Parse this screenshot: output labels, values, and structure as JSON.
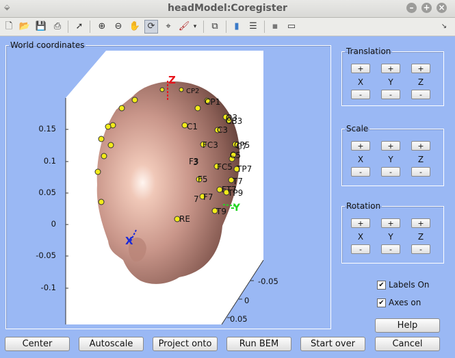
{
  "window": {
    "title": "headModel:Coregister"
  },
  "toolbar": {
    "icons": [
      "new-file-icon",
      "open-folder-icon",
      "save-icon",
      "print-icon",
      "pointer-icon",
      "zoom-in-icon",
      "zoom-out-icon",
      "pan-hand-icon",
      "rotate-3d-icon",
      "data-cursor-icon",
      "brush-icon",
      "brush-menu-icon",
      "link-plot-icon",
      "colorbar-icon",
      "legend-icon",
      "hide-plot-tools-icon",
      "show-plot-tools-icon",
      "dock-icon"
    ],
    "pressed": "rotate-3d-icon"
  },
  "world": {
    "legend": "World coordinates",
    "yticks": [
      "0.15",
      "0.1",
      "0.05",
      "0",
      "-0.05",
      "-0.1"
    ],
    "depth_ticks": [
      "-0.05",
      "0",
      "0.05"
    ],
    "axis_labels": {
      "z": "Z",
      "y": "-Y",
      "x": "X"
    },
    "electrodes": [
      "CP1",
      "CP2",
      "C1",
      "O3",
      "CB3",
      "C3",
      "FC3",
      "CP5",
      "C7",
      "TP7",
      "FC5",
      "F3",
      "F5",
      "F7",
      "FT7",
      "TP9",
      "T7",
      "T9",
      "RE",
      "C5",
      "3",
      "7"
    ],
    "colors": {
      "head": "#c99a8a",
      "electrode": "#f2ea1a",
      "z_axis": "#e8141c",
      "y_axis": "#22d622",
      "x_axis": "#1a2ad8",
      "background": "#9ab8f4"
    }
  },
  "translation": {
    "legend": "Translation",
    "plus": "+",
    "minus": "-",
    "axes": [
      "X",
      "Y",
      "Z"
    ]
  },
  "scale": {
    "legend": "Scale",
    "plus": "+",
    "minus": "-",
    "axes": [
      "X",
      "Y",
      "Z"
    ]
  },
  "rotation": {
    "legend": "Rotation",
    "plus": "+",
    "minus": "-",
    "axes": [
      "X",
      "Y",
      "Z"
    ]
  },
  "options": {
    "labels_on": {
      "label": "Labels On",
      "checked": true,
      "mark": "✔"
    },
    "axes_on": {
      "label": "Axes on",
      "checked": true,
      "mark": "✔"
    }
  },
  "buttons": {
    "help": "Help",
    "center": "Center",
    "autoscale": "Autoscale",
    "project_onto": "Project onto",
    "run_bem": "Run BEM",
    "start_over": "Start over",
    "cancel": "Cancel"
  }
}
